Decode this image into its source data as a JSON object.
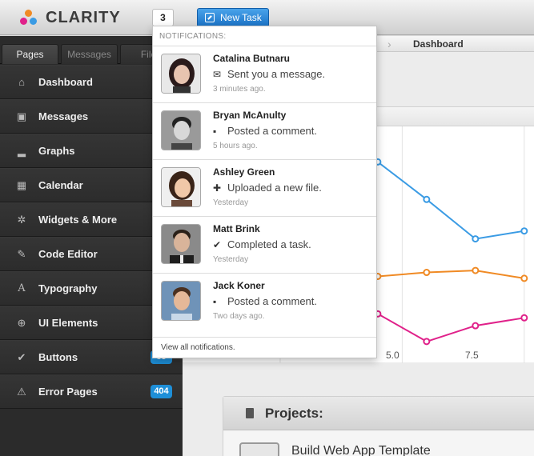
{
  "header": {
    "brand": "CLARITY",
    "notification_count": "3",
    "new_task_label": "New Task"
  },
  "colors": {
    "accent": "#1e8fd8",
    "series_blue": "#3a9be4",
    "series_orange": "#f08a24",
    "series_pink": "#e0218a"
  },
  "sidebar": {
    "tabs": [
      {
        "label": "Pages",
        "active": true
      },
      {
        "label": "Messages",
        "active": false
      },
      {
        "label": "File",
        "active": false
      }
    ],
    "items": [
      {
        "label": "Dashboard",
        "icon": "home-icon",
        "badge": ""
      },
      {
        "label": "Messages",
        "icon": "inbox-icon",
        "badge": ""
      },
      {
        "label": "Graphs",
        "icon": "signal-icon",
        "badge": ""
      },
      {
        "label": "Calendar",
        "icon": "calendar-icon",
        "badge": ""
      },
      {
        "label": "Widgets & More",
        "icon": "cog-icon",
        "badge": ""
      },
      {
        "label": "Code Editor",
        "icon": "edit-icon",
        "badge": ""
      },
      {
        "label": "Typography",
        "icon": "font-icon",
        "badge": ""
      },
      {
        "label": "UI Elements",
        "icon": "plus-circle-icon",
        "badge": ""
      },
      {
        "label": "Buttons",
        "icon": "check-circle-icon",
        "badge": "35"
      },
      {
        "label": "Error Pages",
        "icon": "warning-icon",
        "badge": "404"
      }
    ]
  },
  "breadcrumb": {
    "current": "Dashboard"
  },
  "chart_data": {
    "type": "line",
    "x_tick_labels": [
      "5.0",
      "7.5"
    ],
    "series": [
      {
        "color": "#3a9be4",
        "x": [
          5.0,
          6.0,
          7.0,
          8.0,
          9.0,
          10.0
        ],
        "y": [
          7.4,
          8.0,
          7.7,
          5.8,
          3.8,
          4.2
        ]
      },
      {
        "color": "#f08a24",
        "x": [
          5.0,
          6.0,
          7.0,
          8.0,
          9.0,
          10.0
        ],
        "y": [
          5.0,
          3.3,
          1.9,
          2.1,
          2.2,
          1.8
        ]
      },
      {
        "color": "#e0218a",
        "x": [
          5.0,
          6.0,
          7.0,
          8.0,
          9.0,
          10.0
        ],
        "y": [
          0.4,
          -0.2,
          0.0,
          -1.4,
          -0.6,
          -0.2
        ]
      }
    ],
    "grid": true
  },
  "projects": {
    "title": "Projects:",
    "items": [
      {
        "name": "Build Web App Template"
      }
    ]
  },
  "notifications": {
    "header": "NOTIFICATIONS:",
    "items": [
      {
        "name": "Catalina Butnaru",
        "icon": "envelope-icon",
        "action": "Sent you a message.",
        "time": "3 minutes ago."
      },
      {
        "name": "Bryan McAnulty",
        "icon": "comment-icon",
        "action": "Posted a comment.",
        "time": "5 hours ago."
      },
      {
        "name": "Ashley Green",
        "icon": "plus-icon",
        "action": "Uploaded a new file.",
        "time": "Yesterday"
      },
      {
        "name": "Matt Brink",
        "icon": "check-icon",
        "action": "Completed a task.",
        "time": "Yesterday"
      },
      {
        "name": "Jack Koner",
        "icon": "comment-icon",
        "action": "Posted a comment.",
        "time": "Two days ago."
      }
    ],
    "view_all": "View all notifications."
  }
}
